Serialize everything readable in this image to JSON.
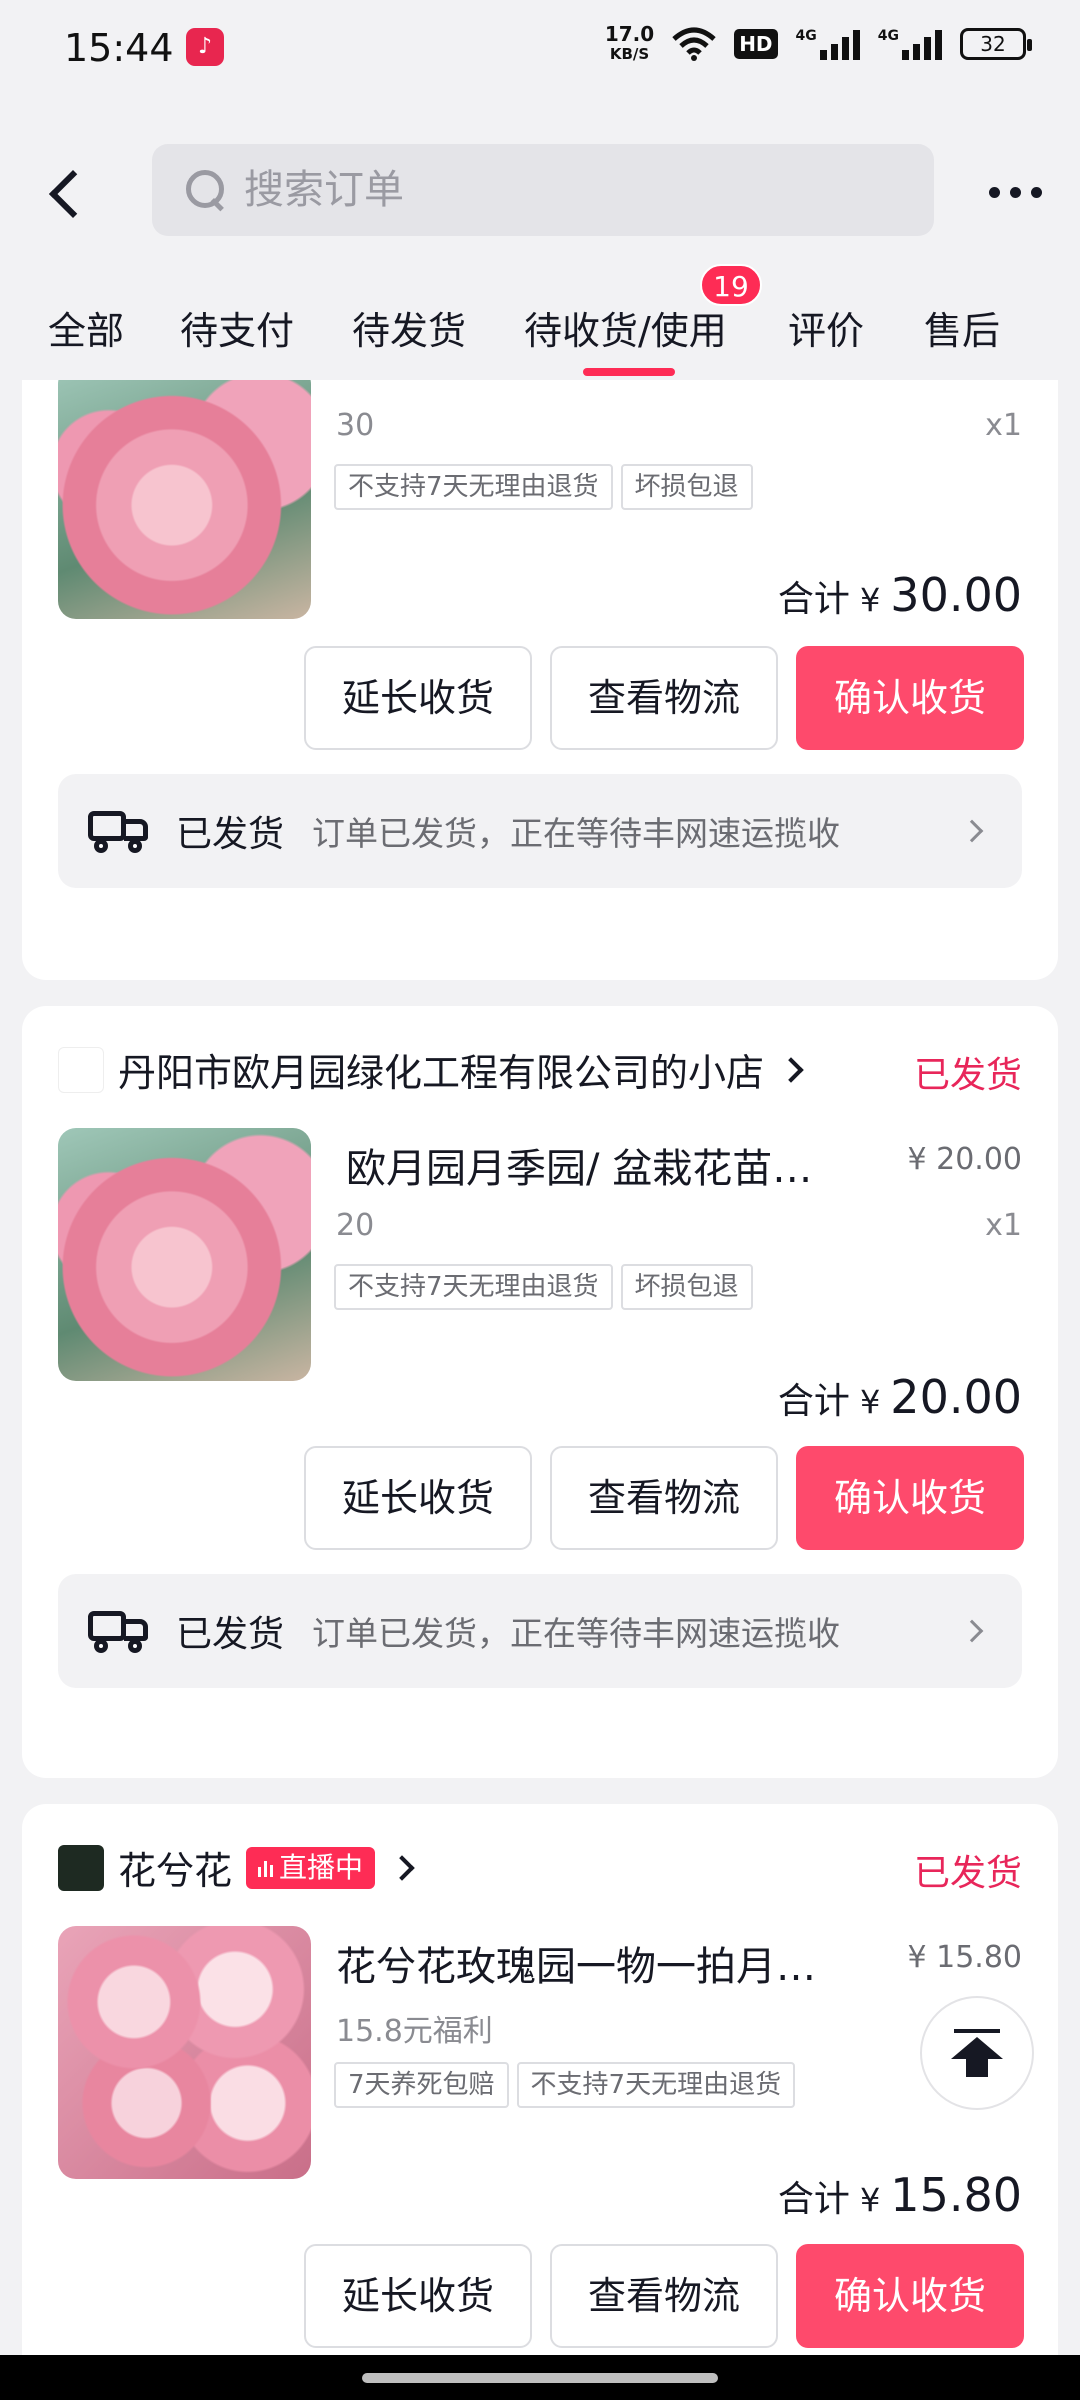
{
  "status_bar": {
    "time": "15:44",
    "net_speed_value": "17.0",
    "net_speed_unit": "KB/S",
    "hd_label": "HD",
    "sim1": "4G",
    "sim2": "4G",
    "battery": "32",
    "app_icon": "douyin-icon",
    "wifi_icon": "wifi-icon"
  },
  "header": {
    "search_placeholder": "搜索订单"
  },
  "tabs": [
    {
      "label": "全部"
    },
    {
      "label": "待支付"
    },
    {
      "label": "待发货"
    },
    {
      "label": "待收货/使用",
      "badge": "19",
      "active": true
    },
    {
      "label": "评价"
    },
    {
      "label": "售后"
    }
  ],
  "orders": [
    {
      "spec": "30",
      "qty": "x1",
      "tags": [
        "不支持7天无理由退货",
        "坏损包退"
      ],
      "total_label": "合计",
      "currency": "¥",
      "total": "30.00",
      "buttons": {
        "extend": "延长收货",
        "logistics": "查看物流",
        "confirm": "确认收货"
      },
      "shipping": {
        "status": "已发货",
        "message": "订单已发货，正在等待丰网速运揽收"
      }
    },
    {
      "shop": "丹阳市欧月园绿化工程有限公司的小店",
      "status": "已发货",
      "title": "欧月园月季园/ 盆栽花苗…",
      "price": "¥ 20.00",
      "spec": "20",
      "qty": "x1",
      "tags": [
        "不支持7天无理由退货",
        "坏损包退"
      ],
      "total_label": "合计",
      "currency": "¥",
      "total": "20.00",
      "buttons": {
        "extend": "延长收货",
        "logistics": "查看物流",
        "confirm": "确认收货"
      },
      "shipping": {
        "status": "已发货",
        "message": "订单已发货，正在等待丰网速运揽收"
      }
    },
    {
      "shop": "花兮花",
      "live": "直播中",
      "status": "已发货",
      "title": "花兮花玫瑰园一物一拍月…",
      "price": "¥ 15.80",
      "spec": "15.8元福利",
      "tags": [
        "7天养死包赔",
        "不支持7天无理由退货"
      ],
      "total_label": "合计",
      "currency": "¥",
      "total": "15.80",
      "buttons": {
        "extend": "延长收货",
        "logistics": "查看物流",
        "confirm": "确认收货"
      }
    }
  ],
  "colors": {
    "accent": "#fe2c55",
    "status_red": "#e8265a",
    "background": "#f2f2f4"
  }
}
